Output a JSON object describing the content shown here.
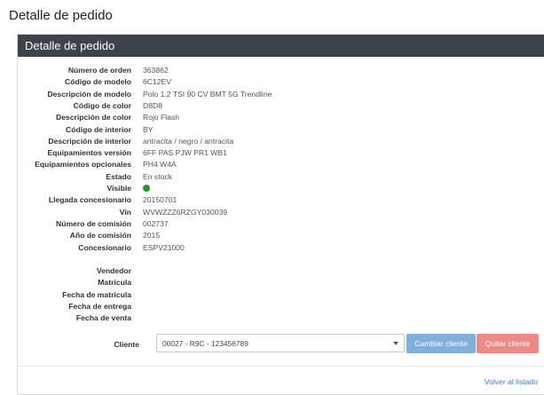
{
  "page": {
    "title": "Detalle de pedido"
  },
  "panel": {
    "heading": "Detalle de pedido"
  },
  "details": [
    {
      "label": "Número de orden",
      "value": "363862"
    },
    {
      "label": "Código de modelo",
      "value": "6C12EV"
    },
    {
      "label": "Descripción de modelo",
      "value": "Polo 1.2 TSI 90 CV BMT 5G Trendline"
    },
    {
      "label": "Código de color",
      "value": "D8D8"
    },
    {
      "label": "Descripción de color",
      "value": "Rojo Flash"
    },
    {
      "label": "Código de interior",
      "value": "BY"
    },
    {
      "label": "Descripción de interior",
      "value": "antracita / negro / antracita"
    },
    {
      "label": "Equipamientos versión",
      "value": "6FF PAS PJW PR1 WB1"
    },
    {
      "label": "Equipamientos opcionales",
      "value": "PH4 W4A"
    },
    {
      "label": "Estado",
      "value": "En stock"
    },
    {
      "label": "Visible",
      "value": ""
    },
    {
      "label": "Llegada concesionario",
      "value": "20150701"
    },
    {
      "label": "Vin",
      "value": "WVWZZZ6RZGY030039"
    },
    {
      "label": "Número de comisión",
      "value": "002737"
    },
    {
      "label": "Año de comisión",
      "value": "2015"
    },
    {
      "label": "Concesionario",
      "value": "ESPV21000"
    }
  ],
  "extra": [
    {
      "label": "Vendedor",
      "value": ""
    },
    {
      "label": "Matrícula",
      "value": ""
    },
    {
      "label": "Fecha de matrícula",
      "value": ""
    },
    {
      "label": "Fecha de entrega",
      "value": ""
    },
    {
      "label": "Fecha de venta",
      "value": ""
    }
  ],
  "visible_status": {
    "color": "#1f9d1f",
    "active": true
  },
  "client": {
    "label": "Cliente",
    "selected": "00027 - R9C - 123456789",
    "change_label": "Cambiar cliente",
    "remove_label": "Quitar cliente"
  },
  "back_link": "Volver al listado"
}
